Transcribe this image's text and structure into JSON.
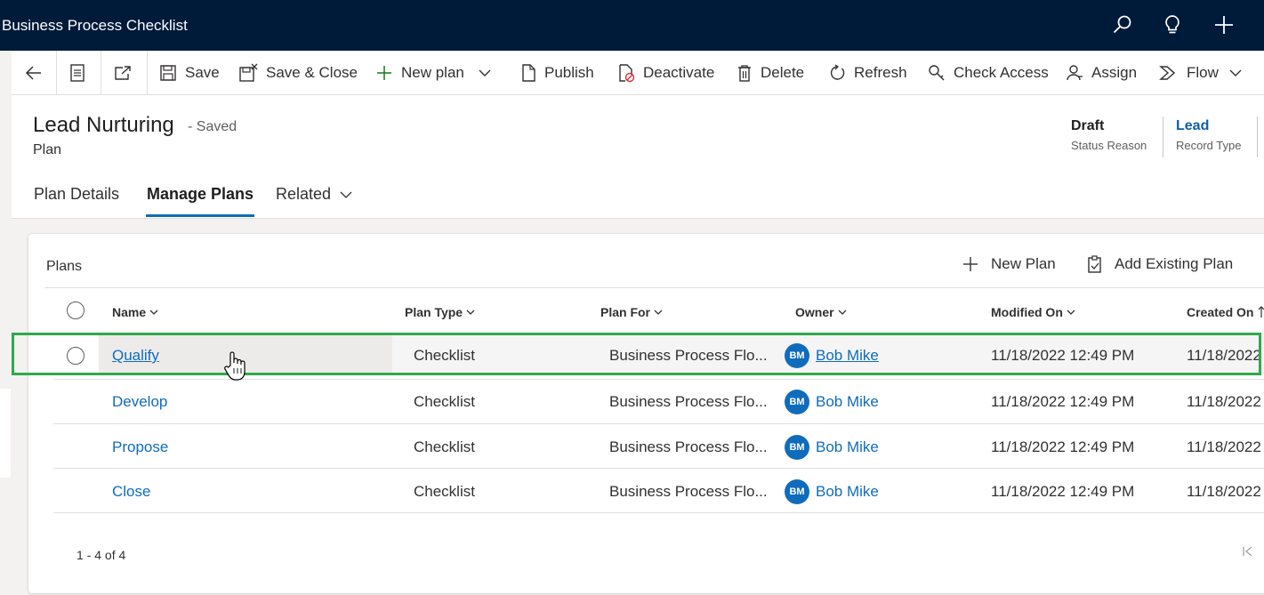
{
  "app": {
    "title": "Business Process Checklist"
  },
  "top_icons": [
    "search-icon",
    "lightbulb-icon",
    "plus-icon"
  ],
  "commands": {
    "save": "Save",
    "save_close": "Save & Close",
    "new_plan": "New plan",
    "publish": "Publish",
    "deactivate": "Deactivate",
    "delete": "Delete",
    "refresh": "Refresh",
    "check_access": "Check Access",
    "assign": "Assign",
    "flow": "Flow"
  },
  "record": {
    "title": "Lead Nurturing",
    "saved_state": "- Saved",
    "entity": "Plan",
    "status_reason_value": "Draft",
    "status_reason_label": "Status Reason",
    "record_type_value": "Lead",
    "record_type_label": "Record Type"
  },
  "tabs": [
    {
      "label": "Plan Details"
    },
    {
      "label": "Manage Plans"
    },
    {
      "label": "Related"
    }
  ],
  "grid": {
    "title": "Plans",
    "new_plan": "New Plan",
    "add_existing_plan": "Add Existing Plan",
    "columns": {
      "name": "Name",
      "plan_type": "Plan Type",
      "plan_for": "Plan For",
      "owner": "Owner",
      "modified_on": "Modified On",
      "created_on": "Created On"
    },
    "rows": [
      {
        "name": "Qualify",
        "plan_type": "Checklist",
        "plan_for": "Business Process Flo...",
        "owner_initials": "BM",
        "owner": "Bob Mike",
        "modified_on": "11/18/2022 12:49 PM",
        "created_on": "11/18/2022"
      },
      {
        "name": "Develop",
        "plan_type": "Checklist",
        "plan_for": "Business Process Flo...",
        "owner_initials": "BM",
        "owner": "Bob Mike",
        "modified_on": "11/18/2022 12:49 PM",
        "created_on": "11/18/2022"
      },
      {
        "name": "Propose",
        "plan_type": "Checklist",
        "plan_for": "Business Process Flo...",
        "owner_initials": "BM",
        "owner": "Bob Mike",
        "modified_on": "11/18/2022 12:49 PM",
        "created_on": "11/18/2022"
      },
      {
        "name": "Close",
        "plan_type": "Checklist",
        "plan_for": "Business Process Flo...",
        "owner_initials": "BM",
        "owner": "Bob Mike",
        "modified_on": "11/18/2022 12:49 PM",
        "created_on": "11/18/2022"
      }
    ],
    "record_count": "1 - 4 of 4"
  },
  "colors": {
    "topbar": "#001a3a",
    "accent": "#0f6cbd",
    "highlight_border": "#2faa4a"
  }
}
